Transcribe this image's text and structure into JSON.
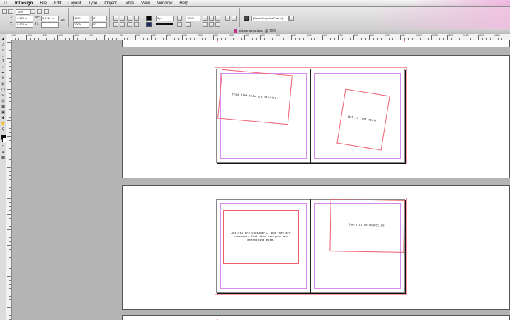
{
  "menubar": {
    "apple": "",
    "app_name": "InDesign",
    "items": [
      "File",
      "Edit",
      "Layout",
      "Type",
      "Object",
      "Table",
      "View",
      "Window",
      "Help"
    ]
  },
  "control_panel": {
    "zoom": "75%",
    "x": "1.028 in",
    "y": "0.823 in",
    "w": "0.7111 in",
    "h": "",
    "scale_x": "100%",
    "scale_y": "100%",
    "rotate": "0°",
    "shear": "0°",
    "stroke_weight": "0 pt",
    "opacity": "100%",
    "object_style": "[Basic Graphics Frame]+",
    "fill_color": "#000000",
    "stroke_color": "#1a2a6e"
  },
  "document": {
    "tab_title": "statements.indd @ 75%"
  },
  "ruler": {
    "numbers": [
      "-300",
      "-250",
      "-200",
      "-150",
      "-100",
      "-50",
      "0",
      "50",
      "100",
      "150",
      "200",
      "250",
      "300",
      "350",
      "400",
      "450",
      "500",
      "550",
      "600",
      "650",
      "700",
      "750",
      "800",
      "850",
      "900",
      "950",
      "1000",
      "1050",
      "1100",
      "1150",
      "1200",
      "1250"
    ]
  },
  "spreads": [
    {
      "frames": [
        {
          "text": "this time this art studies."
        },
        {
          "text": "art is just stuff."
        }
      ]
    },
    {
      "frames": [
        {
          "text": "Artists are consumers, and they are consumed. Just like everyone and everything else."
        },
        {
          "text": "There is no objective."
        }
      ]
    }
  ],
  "colors": {
    "pasteboard": "#b4b4b4",
    "bleed_guide": "#f39aa6",
    "margin_guide": "#d78cf0",
    "frame_edge": "#f0606e",
    "titlebar_accent": "#eeaadc"
  }
}
